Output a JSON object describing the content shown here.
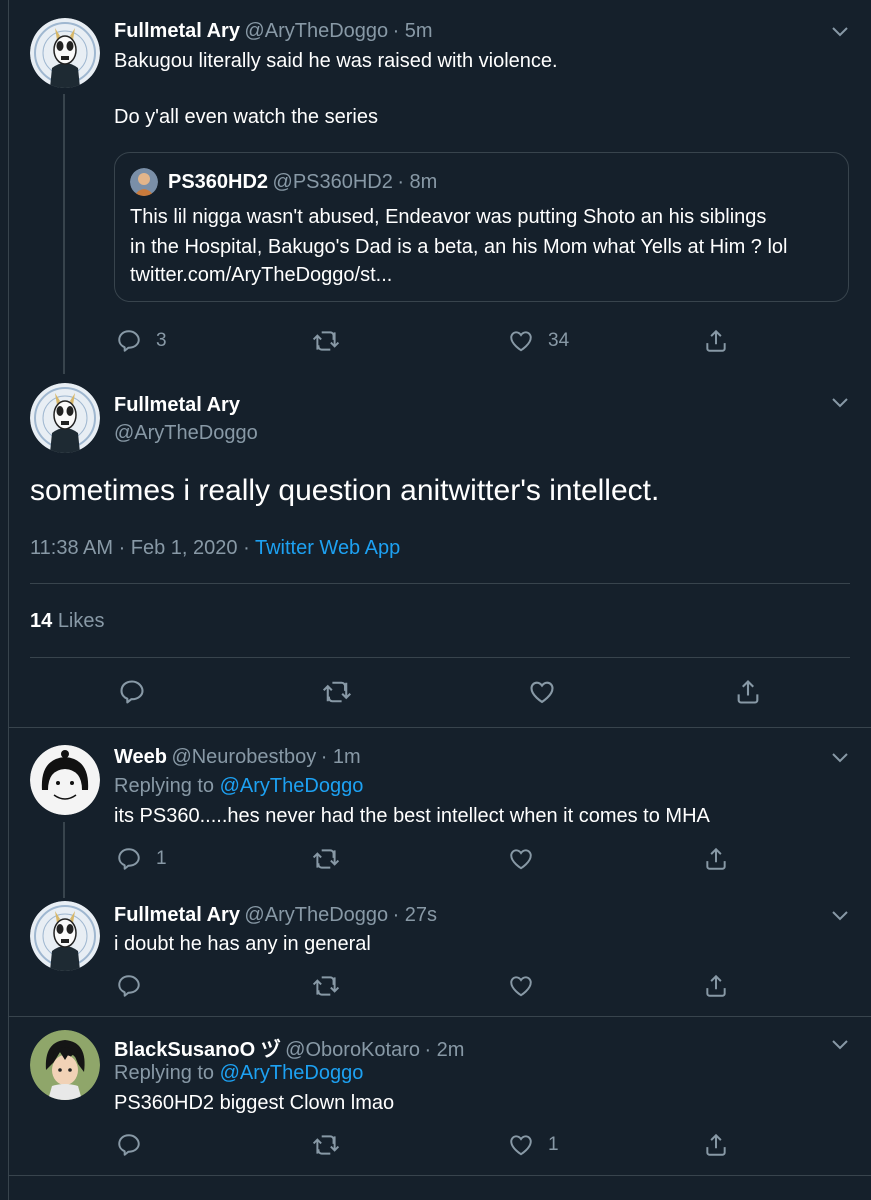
{
  "colors": {
    "background": "#15202b",
    "text": "#ffffff",
    "secondary": "#8899a6",
    "link": "#1da1f2",
    "border": "#38444d"
  },
  "tweet1": {
    "name": "Fullmetal Ary",
    "handle": "@AryTheDoggo",
    "time": "· 5m",
    "line1": "Bakugou literally said he was raised with violence.",
    "line2": "Do y'all even watch the series",
    "quote": {
      "name": "PS360HD2",
      "handle": "@PS360HD2",
      "time": "· 8m",
      "line1": "This lil nigga wasn't abused, Endeavor was putting Shoto an his siblings",
      "line2": "in the Hospital, Bakugo's Dad is a beta, an his Mom what Yells at Him ? lol",
      "line3": "twitter.com/AryTheDoggo/st..."
    },
    "replies": "3",
    "likes": "34"
  },
  "main_tweet": {
    "name": "Fullmetal Ary",
    "handle": "@AryTheDoggo",
    "text": "sometimes i really question anitwitter's intellect.",
    "time": "11:38 AM · Feb 1, 2020 ·",
    "source": "Twitter Web App",
    "likes_count": "14",
    "likes_label": "Likes"
  },
  "reply1": {
    "name": "Weeb",
    "handle": "@Neurobestboy",
    "time": "· 1m",
    "replying_label": "Replying to",
    "replying_to": "@AryTheDoggo",
    "text": "its PS360.....hes never had the best intellect when it comes to MHA",
    "replies": "1"
  },
  "reply2": {
    "name": "Fullmetal Ary",
    "handle": "@AryTheDoggo",
    "time": "· 27s",
    "text": "i doubt he has any in general"
  },
  "reply3": {
    "name": "BlackSusanoO ヅ",
    "handle": "@OboroKotaro",
    "time": "· 2m",
    "replying_label": "Replying to",
    "replying_to": "@AryTheDoggo",
    "text": "PS360HD2 biggest Clown lmao",
    "likes": "1"
  }
}
